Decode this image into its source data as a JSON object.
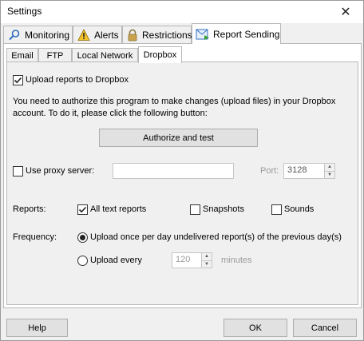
{
  "window": {
    "title": "Settings",
    "close_glyph": "✕"
  },
  "top_tabs": [
    {
      "label": "Monitoring",
      "icon": "magnifier-icon"
    },
    {
      "label": "Alerts",
      "icon": "warning-icon"
    },
    {
      "label": "Restrictions",
      "icon": "lock-icon"
    },
    {
      "label": "Report Sending",
      "icon": "report-sending-icon"
    }
  ],
  "active_top_tab": "Report Sending",
  "sub_tabs": [
    "Email",
    "FTP",
    "Local Network",
    "Dropbox"
  ],
  "active_sub_tab": "Dropbox",
  "dropbox": {
    "upload_label": "Upload reports to Dropbox",
    "upload_checked": true,
    "auth_text_line1": "You need to authorize this program to make changes (upload files) in your Dropbox",
    "auth_text_line2": "account. To do it, please click the following button:",
    "authorize_button": "Authorize and test",
    "proxy_label": "Use proxy server:",
    "proxy_checked": false,
    "proxy_value": "",
    "port_label": "Port:",
    "port_value": "3128",
    "reports_label": "Reports:",
    "reports": [
      {
        "label": "All text reports",
        "checked": true
      },
      {
        "label": "Snapshots",
        "checked": false
      },
      {
        "label": "Sounds",
        "checked": false
      }
    ],
    "frequency_label": "Frequency:",
    "frequency_options": [
      {
        "label": "Upload once per day undelivered report(s) of the previous day(s)",
        "selected": true
      },
      {
        "label": "Upload every",
        "selected": false
      }
    ],
    "interval_value": "120",
    "interval_unit": "minutes"
  },
  "footer": {
    "help": "Help",
    "ok": "OK",
    "cancel": "Cancel"
  },
  "colors": {
    "window_bg": "#f0f0f0",
    "panel_bg": "#ffffff",
    "border": "#b9b9b9",
    "button_bg": "#e1e1e1",
    "icon_blue": "#2f6fbf",
    "warning_yellow": "#f3c22c",
    "lock_gold": "#c9a24a"
  }
}
